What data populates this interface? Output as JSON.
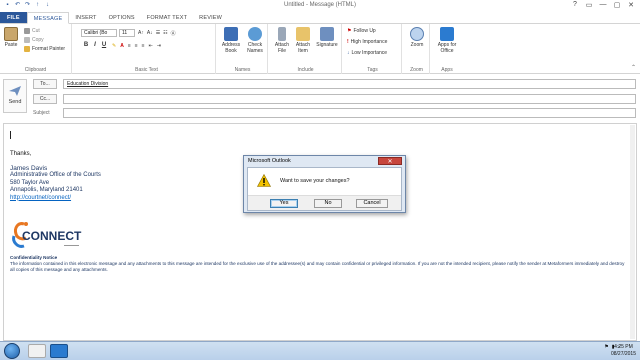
{
  "window": {
    "title": "Untitled - Message (HTML)",
    "controls": [
      "?",
      "▭",
      "—",
      "▢",
      "✕"
    ]
  },
  "tabs": [
    "FILE",
    "MESSAGE",
    "INSERT",
    "OPTIONS",
    "FORMAT TEXT",
    "REVIEW"
  ],
  "ribbon": {
    "clipboard": {
      "paste": "Paste",
      "cut": "Cut",
      "copy": "Copy",
      "format_painter": "Format Painter",
      "label": "Clipboard"
    },
    "basic_text": {
      "font": "Calibri (Bo",
      "size": "11",
      "bold": "B",
      "italic": "I",
      "underline": "U",
      "label": "Basic Text"
    },
    "names": {
      "address_book": "Address Book",
      "check_names": "Check Names",
      "label": "Names"
    },
    "include": {
      "attach_file": "Attach File",
      "attach_item": "Attach Item",
      "signature": "Signature",
      "label": "Include"
    },
    "tags": {
      "follow_up": "Follow Up",
      "high_importance": "High Importance",
      "low_importance": "Low Importance",
      "label": "Tags"
    },
    "zoom": {
      "zoom": "Zoom",
      "label": "Zoom"
    },
    "apps": {
      "apps_for_office": "Apps for Office",
      "label": "Apps"
    }
  },
  "compose": {
    "send": "Send",
    "to_button": "To...",
    "cc_button": "Cc...",
    "subject_label": "Subject",
    "to_value": "Education Division",
    "cc_value": "",
    "subject_value": ""
  },
  "body": {
    "greeting": "Thanks,",
    "sig_name": "James Davis",
    "sig_line1": "Administrative Office of the Courts",
    "sig_line2": "580 Taylor Ave",
    "sig_line3": "Annapolis, Maryland 21401",
    "sig_link": "http://courtnet/connect/",
    "logo_text": "CONNECT",
    "notice_title": "Confidentiality Notice",
    "notice_text": "The information contained in this electronic message and any attachments to this message are intended for the exclusive use of the addressee(s) and may contain confidential or privileged information. If you are not the intended recipient, please notify the sender at Metaformers immediately and destroy all copies of this message and any attachments."
  },
  "dialog": {
    "title": "Microsoft Outlook",
    "message": "Want to save your changes?",
    "yes": "Yes",
    "no": "No",
    "cancel": "Cancel",
    "close": "✕"
  },
  "taskbar": {
    "time": "4:25 PM",
    "date": "08/27/2015"
  },
  "colors": {
    "accent": "#2b579a",
    "close_red": "#c7463d"
  }
}
